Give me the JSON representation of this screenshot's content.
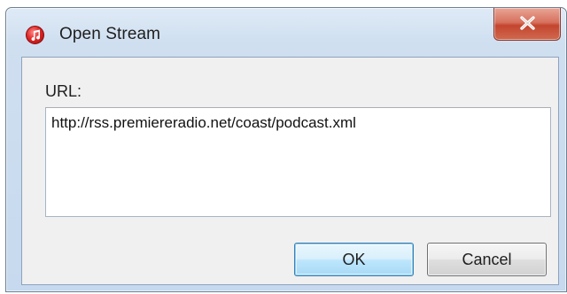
{
  "window": {
    "title": "Open Stream",
    "app_icon": "music-note-icon",
    "close_icon": "close-icon"
  },
  "form": {
    "url_label": "URL:",
    "url_value": "http://rss.premiereradio.net/coast/podcast.xml"
  },
  "buttons": {
    "ok_label": "OK",
    "cancel_label": "Cancel"
  },
  "colors": {
    "close_button": "#c4452e",
    "default_button_border": "#3c7fb1",
    "app_icon": "#e02828"
  }
}
